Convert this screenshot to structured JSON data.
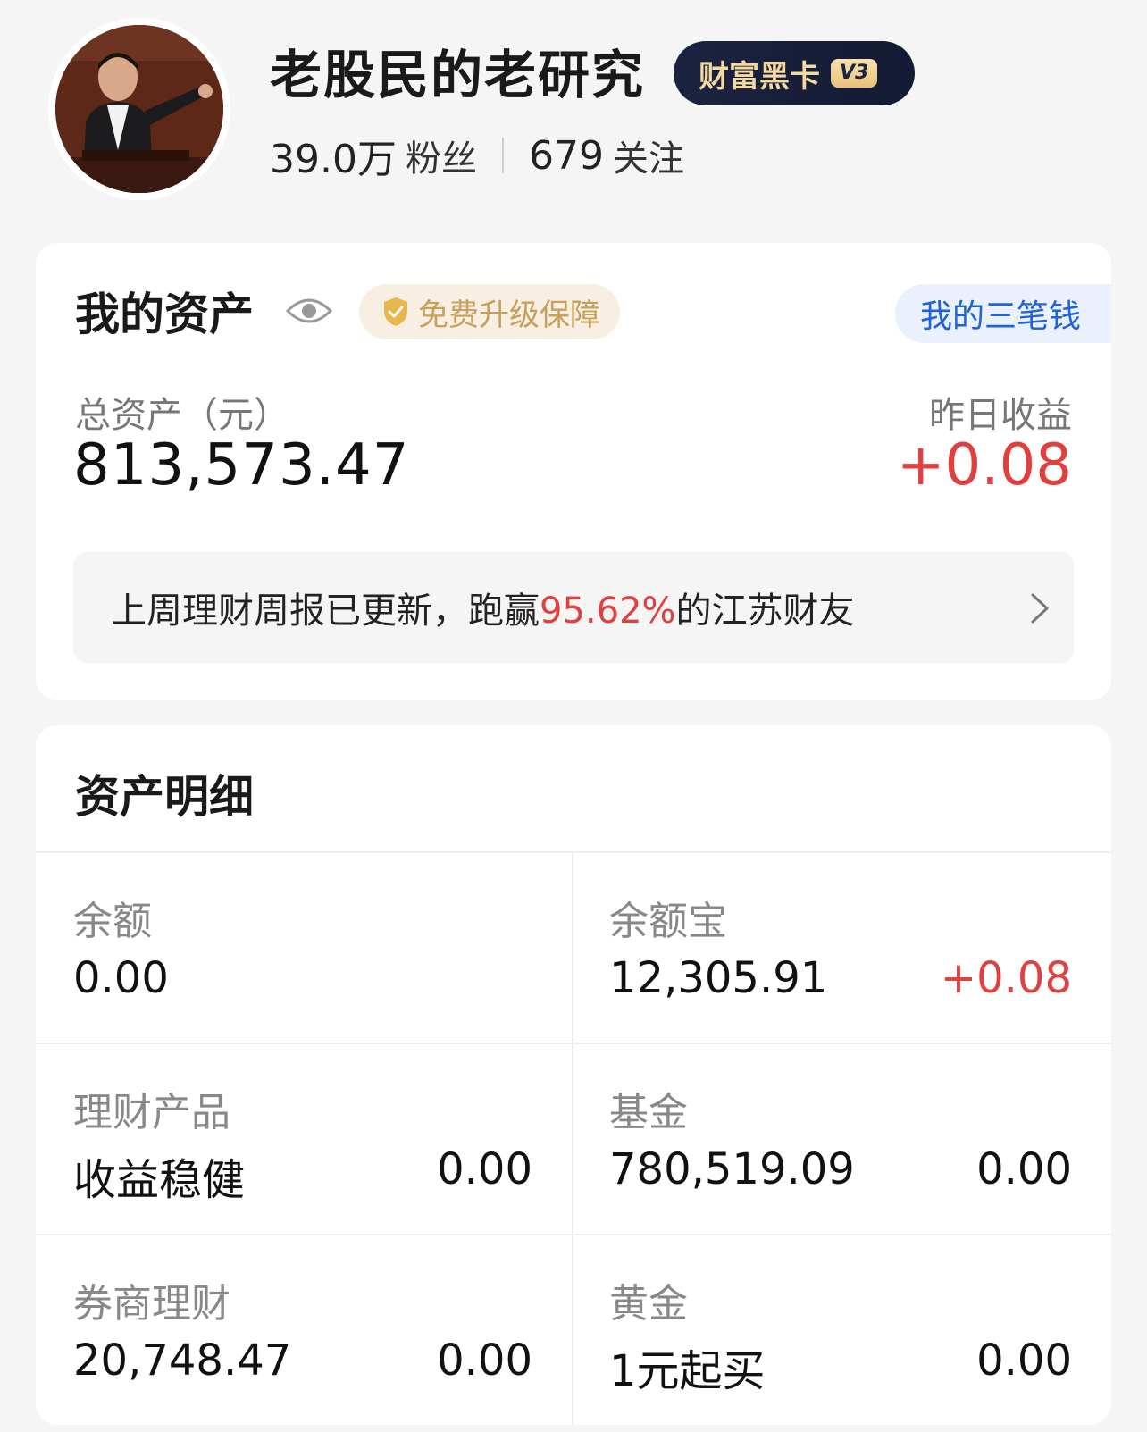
{
  "profile": {
    "nickname": "老股民的老研究",
    "vip_text": "财富黑卡",
    "vip_level": "V3",
    "followers_count": "39.0万",
    "followers_label": "粉丝",
    "following_count": "679",
    "following_label": "关注"
  },
  "assets": {
    "title": "我的资产",
    "upgrade_label": "免费升级保障",
    "three_money_label": "我的三笔钱",
    "total_label": "总资产（元）",
    "total_value": "813,573.47",
    "yesterday_label": "昨日收益",
    "yesterday_value": "+0.08",
    "weekly_prefix": "上周理财周报已更新，跑赢",
    "weekly_pct": "95.62%",
    "weekly_suffix": "的江苏财友"
  },
  "detail": {
    "title": "资产明细",
    "items": [
      {
        "label": "余额",
        "main": "0.00",
        "side": ""
      },
      {
        "label": "余额宝",
        "main": "12,305.91",
        "side": "+0.08"
      },
      {
        "label": "理财产品",
        "main": "收益稳健",
        "side": "0.00"
      },
      {
        "label": "基金",
        "main": "780,519.09",
        "side": "0.00"
      },
      {
        "label": "券商理财",
        "main": "20,748.47",
        "side": "0.00"
      },
      {
        "label": "黄金",
        "main": "1元起买",
        "side": "0.00"
      }
    ]
  },
  "colors": {
    "accent_red": "#e0413f",
    "link_blue": "#1e63d8",
    "gold": "#c9a05a",
    "vip_bg": "#1c2340"
  },
  "icons": [
    "eye-icon",
    "shield-icon",
    "chevron-right-icon"
  ]
}
